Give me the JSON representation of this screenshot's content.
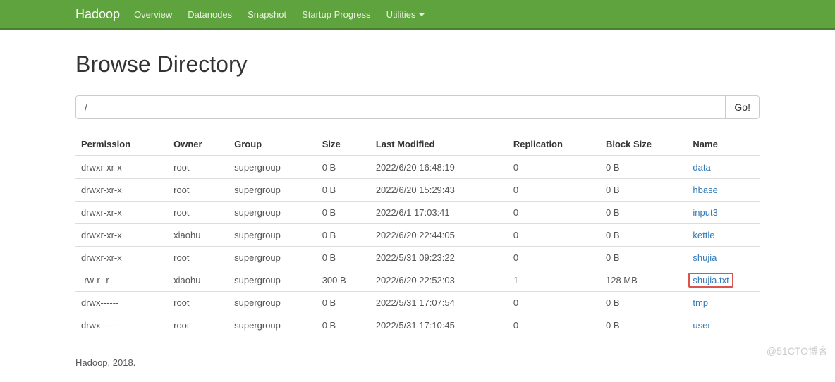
{
  "nav": {
    "brand": "Hadoop",
    "items": [
      "Overview",
      "Datanodes",
      "Snapshot",
      "Startup Progress",
      "Utilities"
    ]
  },
  "page": {
    "title": "Browse Directory",
    "path_value": "/",
    "go_label": "Go!"
  },
  "columns": [
    "Permission",
    "Owner",
    "Group",
    "Size",
    "Last Modified",
    "Replication",
    "Block Size",
    "Name"
  ],
  "rows": [
    {
      "perm": "drwxr-xr-x",
      "owner": "root",
      "group": "supergroup",
      "size": "0 B",
      "mod": "2022/6/20 16:48:19",
      "rep": "0",
      "bs": "0 B",
      "name": "data",
      "hl": false
    },
    {
      "perm": "drwxr-xr-x",
      "owner": "root",
      "group": "supergroup",
      "size": "0 B",
      "mod": "2022/6/20 15:29:43",
      "rep": "0",
      "bs": "0 B",
      "name": "hbase",
      "hl": false
    },
    {
      "perm": "drwxr-xr-x",
      "owner": "root",
      "group": "supergroup",
      "size": "0 B",
      "mod": "2022/6/1 17:03:41",
      "rep": "0",
      "bs": "0 B",
      "name": "input3",
      "hl": false
    },
    {
      "perm": "drwxr-xr-x",
      "owner": "xiaohu",
      "group": "supergroup",
      "size": "0 B",
      "mod": "2022/6/20 22:44:05",
      "rep": "0",
      "bs": "0 B",
      "name": "kettle",
      "hl": false
    },
    {
      "perm": "drwxr-xr-x",
      "owner": "root",
      "group": "supergroup",
      "size": "0 B",
      "mod": "2022/5/31 09:23:22",
      "rep": "0",
      "bs": "0 B",
      "name": "shujia",
      "hl": false
    },
    {
      "perm": "-rw-r--r--",
      "owner": "xiaohu",
      "group": "supergroup",
      "size": "300 B",
      "mod": "2022/6/20 22:52:03",
      "rep": "1",
      "bs": "128 MB",
      "name": "shujia.txt",
      "hl": true
    },
    {
      "perm": "drwx------",
      "owner": "root",
      "group": "supergroup",
      "size": "0 B",
      "mod": "2022/5/31 17:07:54",
      "rep": "0",
      "bs": "0 B",
      "name": "tmp",
      "hl": false
    },
    {
      "perm": "drwx------",
      "owner": "root",
      "group": "supergroup",
      "size": "0 B",
      "mod": "2022/5/31 17:10:45",
      "rep": "0",
      "bs": "0 B",
      "name": "user",
      "hl": false
    }
  ],
  "footer": "Hadoop, 2018.",
  "watermark": "@51CTO博客"
}
